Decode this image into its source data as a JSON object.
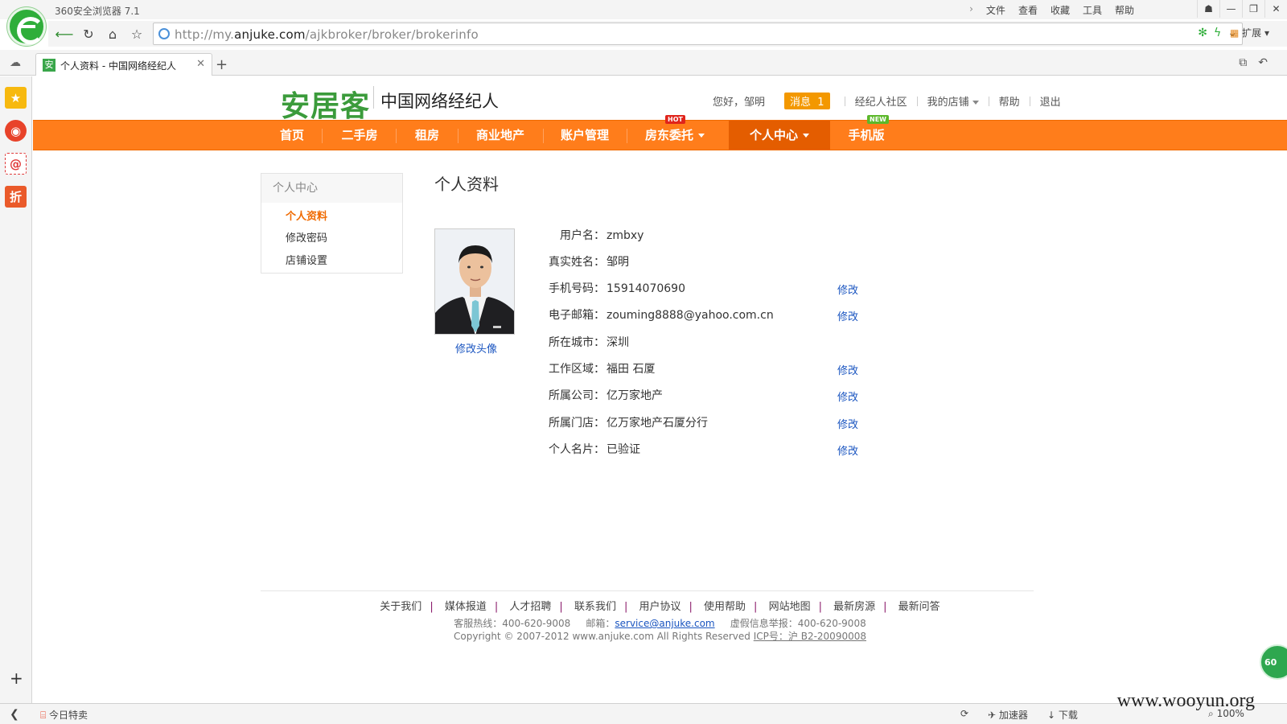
{
  "browser": {
    "title": "360安全浏览器 7.1",
    "menus": [
      "文件",
      "查看",
      "收藏",
      "工具",
      "帮助"
    ],
    "url_prefix": "http://my.",
    "url_domain": "anjuke.com",
    "url_path": "/ajkbroker/broker/brokerinfo",
    "extensions_label": "扩展",
    "tab_title": "个人资料 - 中国网络经纪人",
    "tab_favicon": "安"
  },
  "site": {
    "logo": "安居客",
    "subtitle": "中国网络经纪人",
    "greeting": "您好，邹明",
    "message_label": "消息",
    "message_count": "1",
    "community": "经纪人社区",
    "my_store": "我的店铺",
    "help": "帮助",
    "logout": "退出"
  },
  "nav": {
    "items": [
      "首页",
      "二手房",
      "租房",
      "商业地产",
      "账户管理",
      "房东委托",
      "个人中心",
      "手机版"
    ],
    "hot_badge": "HOT",
    "new_badge": "NEW"
  },
  "sidebar": {
    "title": "个人中心",
    "links": [
      "个人资料",
      "修改密码",
      "店铺设置"
    ]
  },
  "profile": {
    "title": "个人资料",
    "change_avatar": "修改头像",
    "edit_label": "修改",
    "fields": [
      {
        "label": "用户名：",
        "value": "zmbxy"
      },
      {
        "label": "真实姓名：",
        "value": "邹明"
      },
      {
        "label": "手机号码：",
        "value": "15914070690"
      },
      {
        "label": "电子邮箱：",
        "value": "zouming8888@yahoo.com.cn"
      },
      {
        "label": "所在城市：",
        "value": "深圳"
      },
      {
        "label": "工作区域：",
        "value": "福田 石厦"
      },
      {
        "label": "所属公司：",
        "value": "亿万家地产"
      },
      {
        "label": "所属门店：",
        "value": "亿万家地产石厦分行"
      },
      {
        "label": "个人名片：",
        "value": "已验证"
      }
    ]
  },
  "footer": {
    "links": [
      "关于我们",
      "媒体报道",
      "人才招聘",
      "联系我们",
      "用户协议",
      "使用帮助",
      "网站地图",
      "最新房源",
      "最新问答"
    ],
    "hotline": "客服热线：400-620-9008",
    "email_label": "邮箱：",
    "email": "service@anjuke.com",
    "report": "虚假信息举报：400-620-9008",
    "copyright": "Copyright © 2007-2012 www.anjuke.com All Rights Reserved",
    "icp": "ICP号：沪 B2-20090008"
  },
  "statusbar": {
    "today_deals": "今日特卖",
    "accelerator": "加速器",
    "download": "下载",
    "zoom": "100%"
  },
  "watermark": "www.wooyun.org",
  "float_ball": "60",
  "colors": {
    "nav_orange": "#ff7d1b",
    "nav_active": "#e45d00",
    "logo_green": "#3b9b3b",
    "link_blue": "#1a55c0",
    "badge_orange": "#f39800"
  }
}
